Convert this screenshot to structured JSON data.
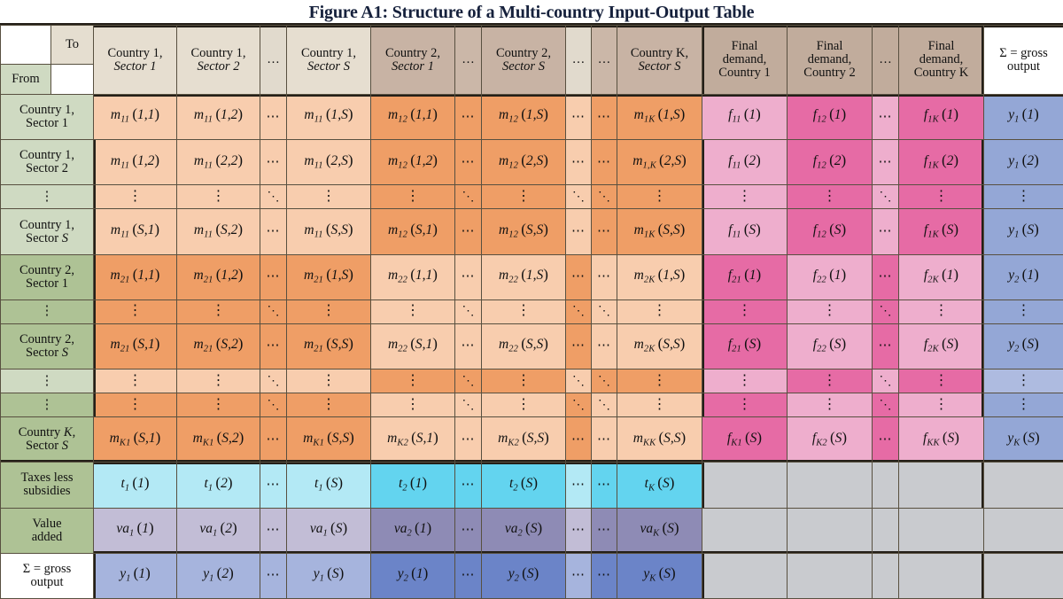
{
  "title": "Figure A1: Structure of a Multi-country Input-Output Table",
  "corner": {
    "to_label": "To",
    "from_label": "From"
  },
  "colors": {
    "header_light": "#e6ded0",
    "header_dark": "#c8b3a4",
    "row_label_light": "#cfdac2",
    "row_label_dark": "#aec295",
    "intermediate_light": "#f8cdae",
    "intermediate_dark": "#ef9e66",
    "final_demand_light": "#eeaecd",
    "final_demand_dark": "#e66ba5",
    "gross_output": "#94a7d6",
    "taxes_light": "#b3e9f5",
    "taxes_dark": "#63d4ef",
    "value_added_light": "#c2bdd6",
    "value_added_dark": "#8e8bb5",
    "empty_grey": "#c9cbcf",
    "border": "#241f18"
  },
  "column_headers": [
    {
      "line1": "Country 1,",
      "line2": "Sector 1"
    },
    {
      "line1": "Country 1,",
      "line2": "Sector 2"
    },
    {
      "line1": "…",
      "line2": ""
    },
    {
      "line1": "Country 1,",
      "line2": "Sector S"
    },
    {
      "line1": "Country 2,",
      "line2": "Sector 1"
    },
    {
      "line1": "…",
      "line2": ""
    },
    {
      "line1": "Country 2,",
      "line2": "Sector S"
    },
    {
      "line1": "…",
      "line2": ""
    },
    {
      "line1": "…",
      "line2": ""
    },
    {
      "line1": "Country K,",
      "line2": "Sector S"
    },
    {
      "line1": "Final",
      "line2": "demand,",
      "line3": "Country 1"
    },
    {
      "line1": "Final",
      "line2": "demand,",
      "line3": "Country 2"
    },
    {
      "line1": "…",
      "line2": "",
      "line3": ""
    },
    {
      "line1": "Final",
      "line2": "demand,",
      "line3": "Country K"
    },
    {
      "line1": "Σ = gross",
      "line2": "output"
    }
  ],
  "row_headers": [
    {
      "line1": "Country 1,",
      "line2": "Sector 1"
    },
    {
      "line1": "Country 1,",
      "line2": "Sector 2"
    },
    {
      "line1": "⋮",
      "line2": ""
    },
    {
      "line1": "Country 1,",
      "line2": "Sector S"
    },
    {
      "line1": "Country 2,",
      "line2": "Sector 1"
    },
    {
      "line1": "⋮",
      "line2": ""
    },
    {
      "line1": "Country 2,",
      "line2": "Sector S"
    },
    {
      "line1": "⋮",
      "line2": ""
    },
    {
      "line1": "⋮",
      "line2": ""
    },
    {
      "line1": "Country K,",
      "line2": "Sector S"
    },
    {
      "line1": "Taxes less",
      "line2": "subsidies"
    },
    {
      "line1": "Value",
      "line2": "added"
    },
    {
      "line1": "Σ = gross",
      "line2": "output"
    }
  ],
  "cells": {
    "r1": [
      "m|11|(1,1)",
      "m|11|(1,2)",
      "⋯",
      "m|11|(1,S)",
      "m|12|(1,1)",
      "⋯",
      "m|12|(1,S)",
      "⋯",
      "⋯",
      "m|1K|(1,S)",
      "f|11|(1)",
      "f|12|(1)",
      "⋯",
      "f|1K|(1)",
      "y|1|(1)"
    ],
    "r2": [
      "m|11|(1,2)",
      "m|11|(2,2)",
      "⋯",
      "m|11|(2,S)",
      "m|12|(1,2)",
      "⋯",
      "m|12|(2,S)",
      "⋯",
      "⋯",
      "m|1,K|(2,S)",
      "f|11|(2)",
      "f|12|(2)",
      "⋯",
      "f|1K|(2)",
      "y|1|(2)"
    ],
    "r3": [
      "⋮",
      "⋮",
      "⋱",
      "⋮",
      "⋮",
      "⋱",
      "⋮",
      "⋱",
      "⋱",
      "⋮",
      "⋮",
      "⋮",
      "⋱",
      "⋮",
      "⋮"
    ],
    "r4": [
      "m|11|(S,1)",
      "m|11|(S,2)",
      "⋯",
      "m|11|(S,S)",
      "m|12|(S,1)",
      "⋯",
      "m|12|(S,S)",
      "⋯",
      "⋯",
      "m|1K|(S,S)",
      "f|11|(S)",
      "f|12|(S)",
      "⋯",
      "f|1K|(S)",
      "y|1|(S)"
    ],
    "r5": [
      "m|21|(1,1)",
      "m|21|(1,2)",
      "⋯",
      "m|21|(1,S)",
      "m|22|(1,1)",
      "⋯",
      "m|22|(1,S)",
      "⋯",
      "⋯",
      "m|2K|(1,S)",
      "f|21|(1)",
      "f|22|(1)",
      "⋯",
      "f|2K|(1)",
      "y|2|(1)"
    ],
    "r6": [
      "⋮",
      "⋮",
      "⋱",
      "⋮",
      "⋮",
      "⋱",
      "⋮",
      "⋱",
      "⋱",
      "⋮",
      "⋮",
      "⋮",
      "⋱",
      "⋮",
      "⋮"
    ],
    "r7": [
      "m|21|(S,1)",
      "m|21|(S,2)",
      "⋯",
      "m|21|(S,S)",
      "m|22|(S,1)",
      "⋯",
      "m|22|(S,S)",
      "⋯",
      "⋯",
      "m|2K|(S,S)",
      "f|21|(S)",
      "f|22|(S)",
      "⋯",
      "f|2K|(S)",
      "y|2|(S)"
    ],
    "r8": [
      "⋮",
      "⋮",
      "⋱",
      "⋮",
      "⋮",
      "⋱",
      "⋮",
      "⋱",
      "⋱",
      "⋮",
      "⋮",
      "⋮",
      "⋱",
      "⋮",
      "⋮"
    ],
    "r9": [
      "⋮",
      "⋮",
      "⋱",
      "⋮",
      "⋮",
      "⋱",
      "⋮",
      "⋱",
      "⋱",
      "⋮",
      "⋮",
      "⋮",
      "⋱",
      "⋮",
      "⋮"
    ],
    "r10": [
      "m|K1|(S,1)",
      "m|K1|(S,2)",
      "⋯",
      "m|K1|(S,S)",
      "m|K2|(S,1)",
      "⋯",
      "m|K2|(S,S)",
      "⋯",
      "⋯",
      "m|KK|(S,S)",
      "f|K1|(S)",
      "f|K2|(S)",
      "⋯",
      "f|KK|(S)",
      "y|K|(S)"
    ],
    "r11": [
      "t|1|(1)",
      "t|1|(2)",
      "⋯",
      "t|1|(S)",
      "t|2|(1)",
      "⋯",
      "t|2|(S)",
      "⋯",
      "⋯",
      "t|K|(S)",
      "",
      "",
      "",
      "",
      ""
    ],
    "r12": [
      "va|1|(1)",
      "va|1|(2)",
      "⋯",
      "va|1|(S)",
      "va|2|(1)",
      "⋯",
      "va|2|(S)",
      "⋯",
      "⋯",
      "va|K|(S)",
      "",
      "",
      "",
      "",
      ""
    ],
    "r13": [
      "y|1|(1)",
      "y|1|(2)",
      "⋯",
      "y|1|(S)",
      "y|2|(1)",
      "⋯",
      "y|2|(S)",
      "⋯",
      "⋯",
      "y|K|(S)",
      "",
      "",
      "",
      "",
      ""
    ]
  }
}
